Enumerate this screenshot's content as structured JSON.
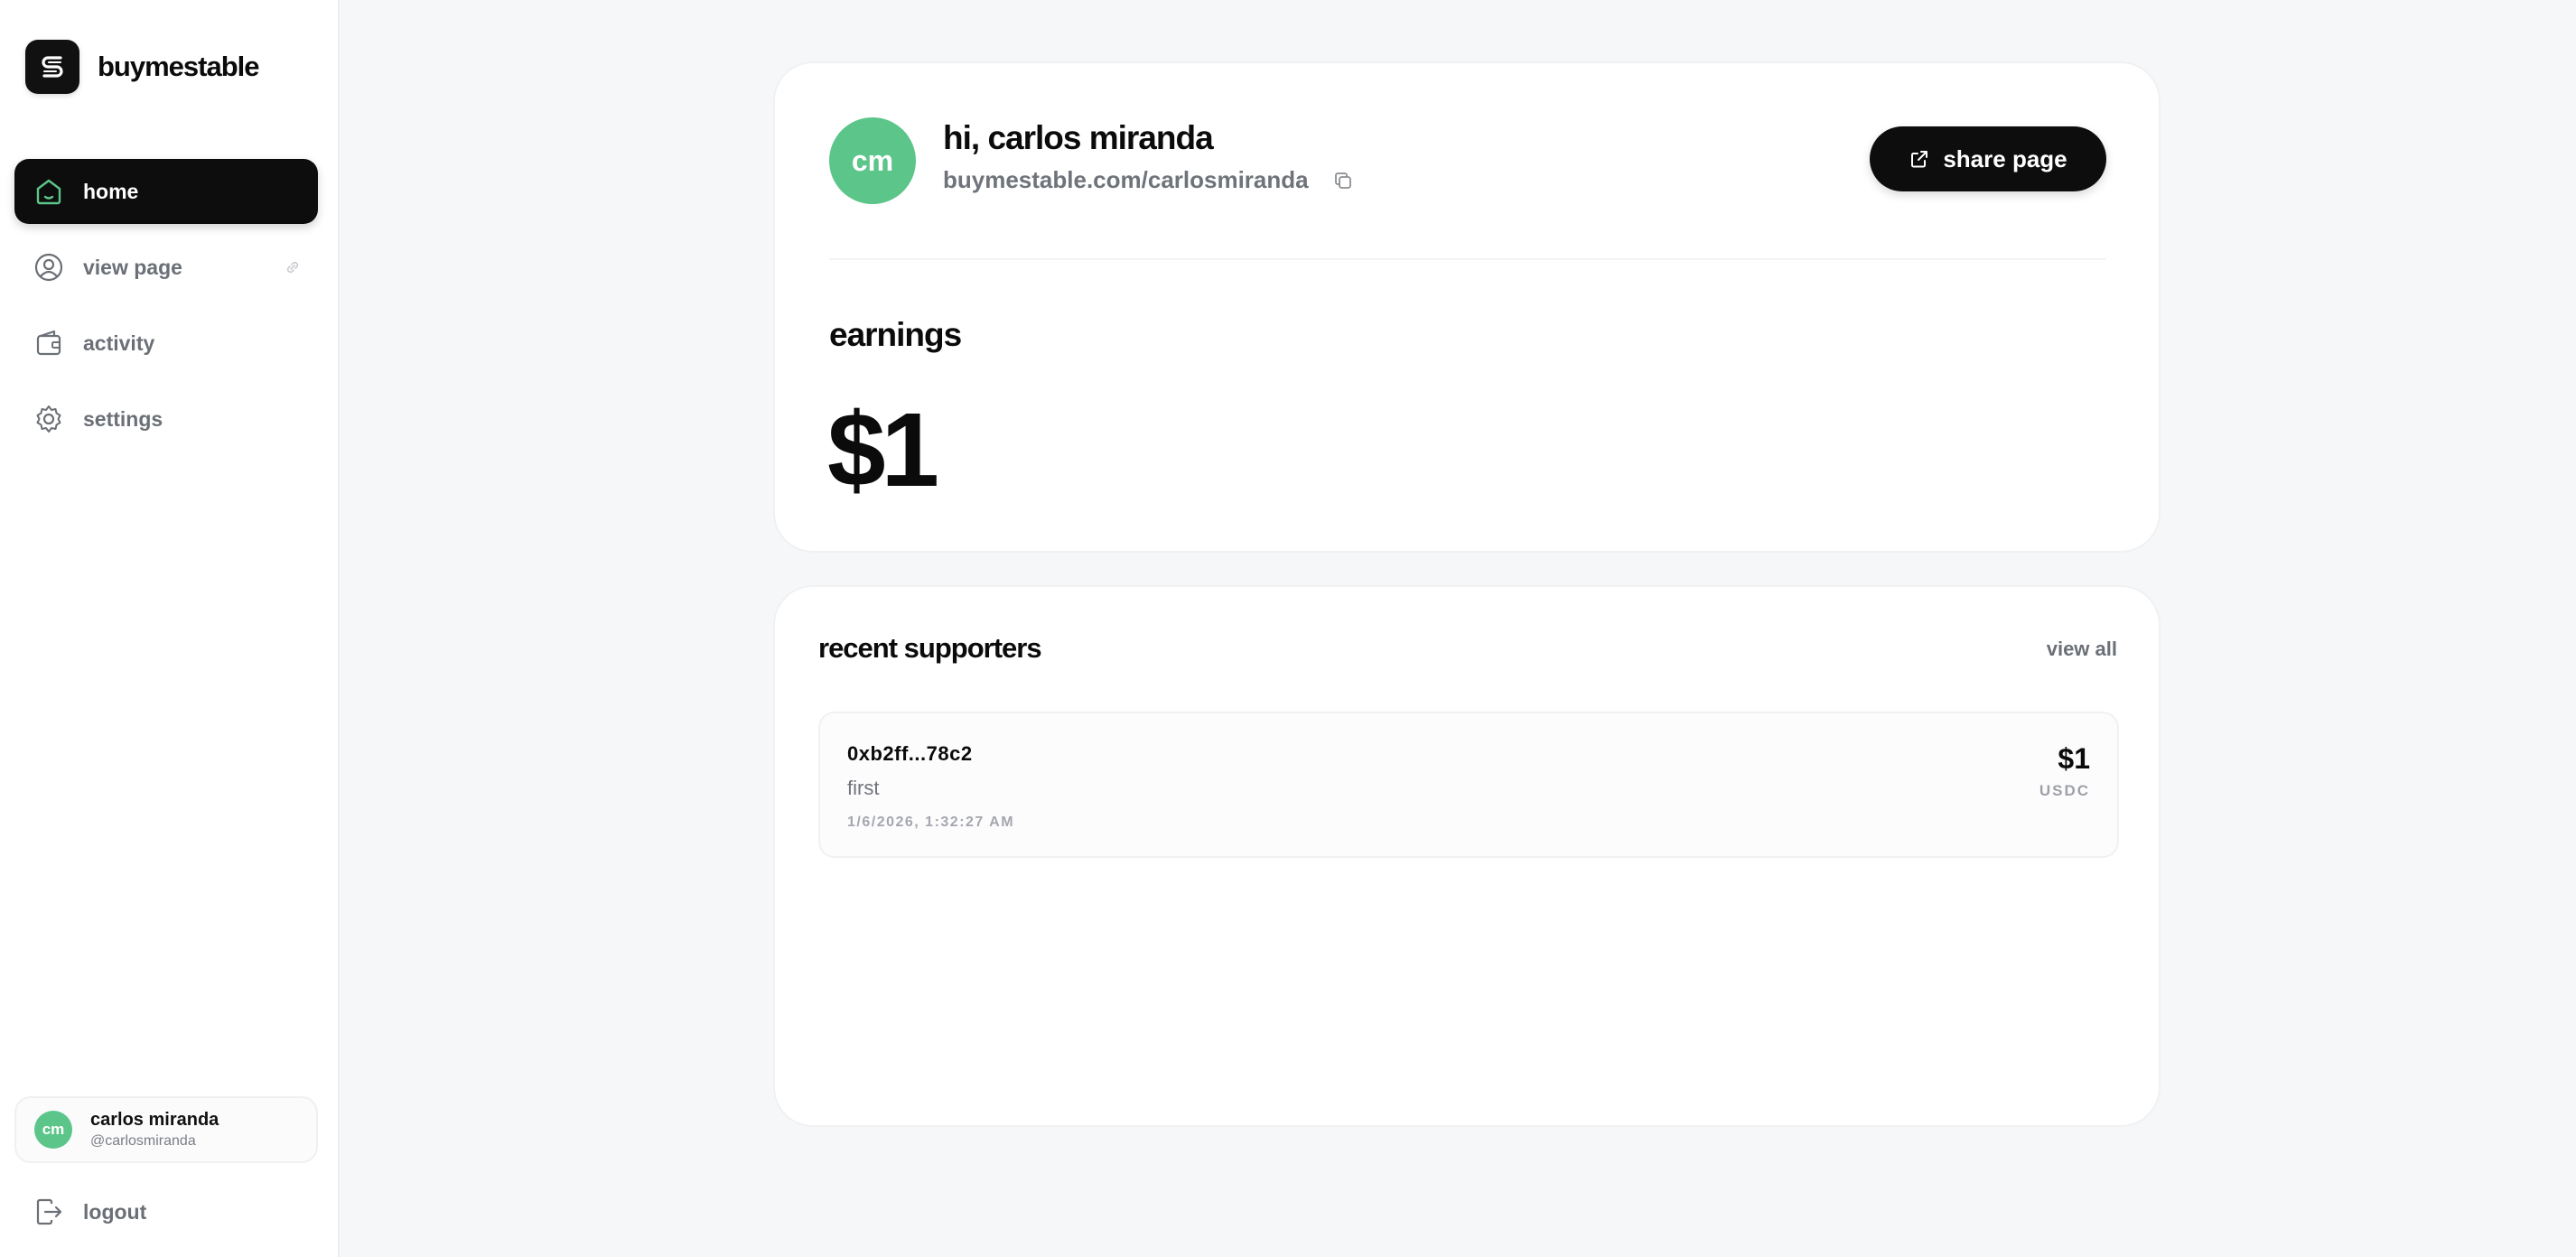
{
  "brand": {
    "name": "buymestable"
  },
  "nav": {
    "items": [
      {
        "label": "home",
        "icon": "home-icon"
      },
      {
        "label": "view page",
        "icon": "user-circle-icon"
      },
      {
        "label": "activity",
        "icon": "wallet-icon"
      },
      {
        "label": "settings",
        "icon": "gear-icon"
      }
    ],
    "active": "home",
    "logout_label": "logout"
  },
  "profile": {
    "initials": "cm",
    "name": "carlos miranda",
    "handle": "@carlosmiranda"
  },
  "header": {
    "greeting": "hi, carlos miranda",
    "page_url": "buymestable.com/carlosmiranda",
    "share_label": "share page"
  },
  "earnings": {
    "title": "earnings",
    "value": "$1"
  },
  "supporters": {
    "title": "recent supporters",
    "view_all_label": "view all",
    "items": [
      {
        "address": "0xb2ff...78c2",
        "message": "first",
        "timestamp": "1/6/2026, 1:32:27 AM",
        "amount": "$1",
        "currency": "USDC"
      }
    ]
  },
  "colors": {
    "accent_green": "#5cc58a",
    "dark": "#0d0d0d",
    "background": "#f6f7f9"
  }
}
